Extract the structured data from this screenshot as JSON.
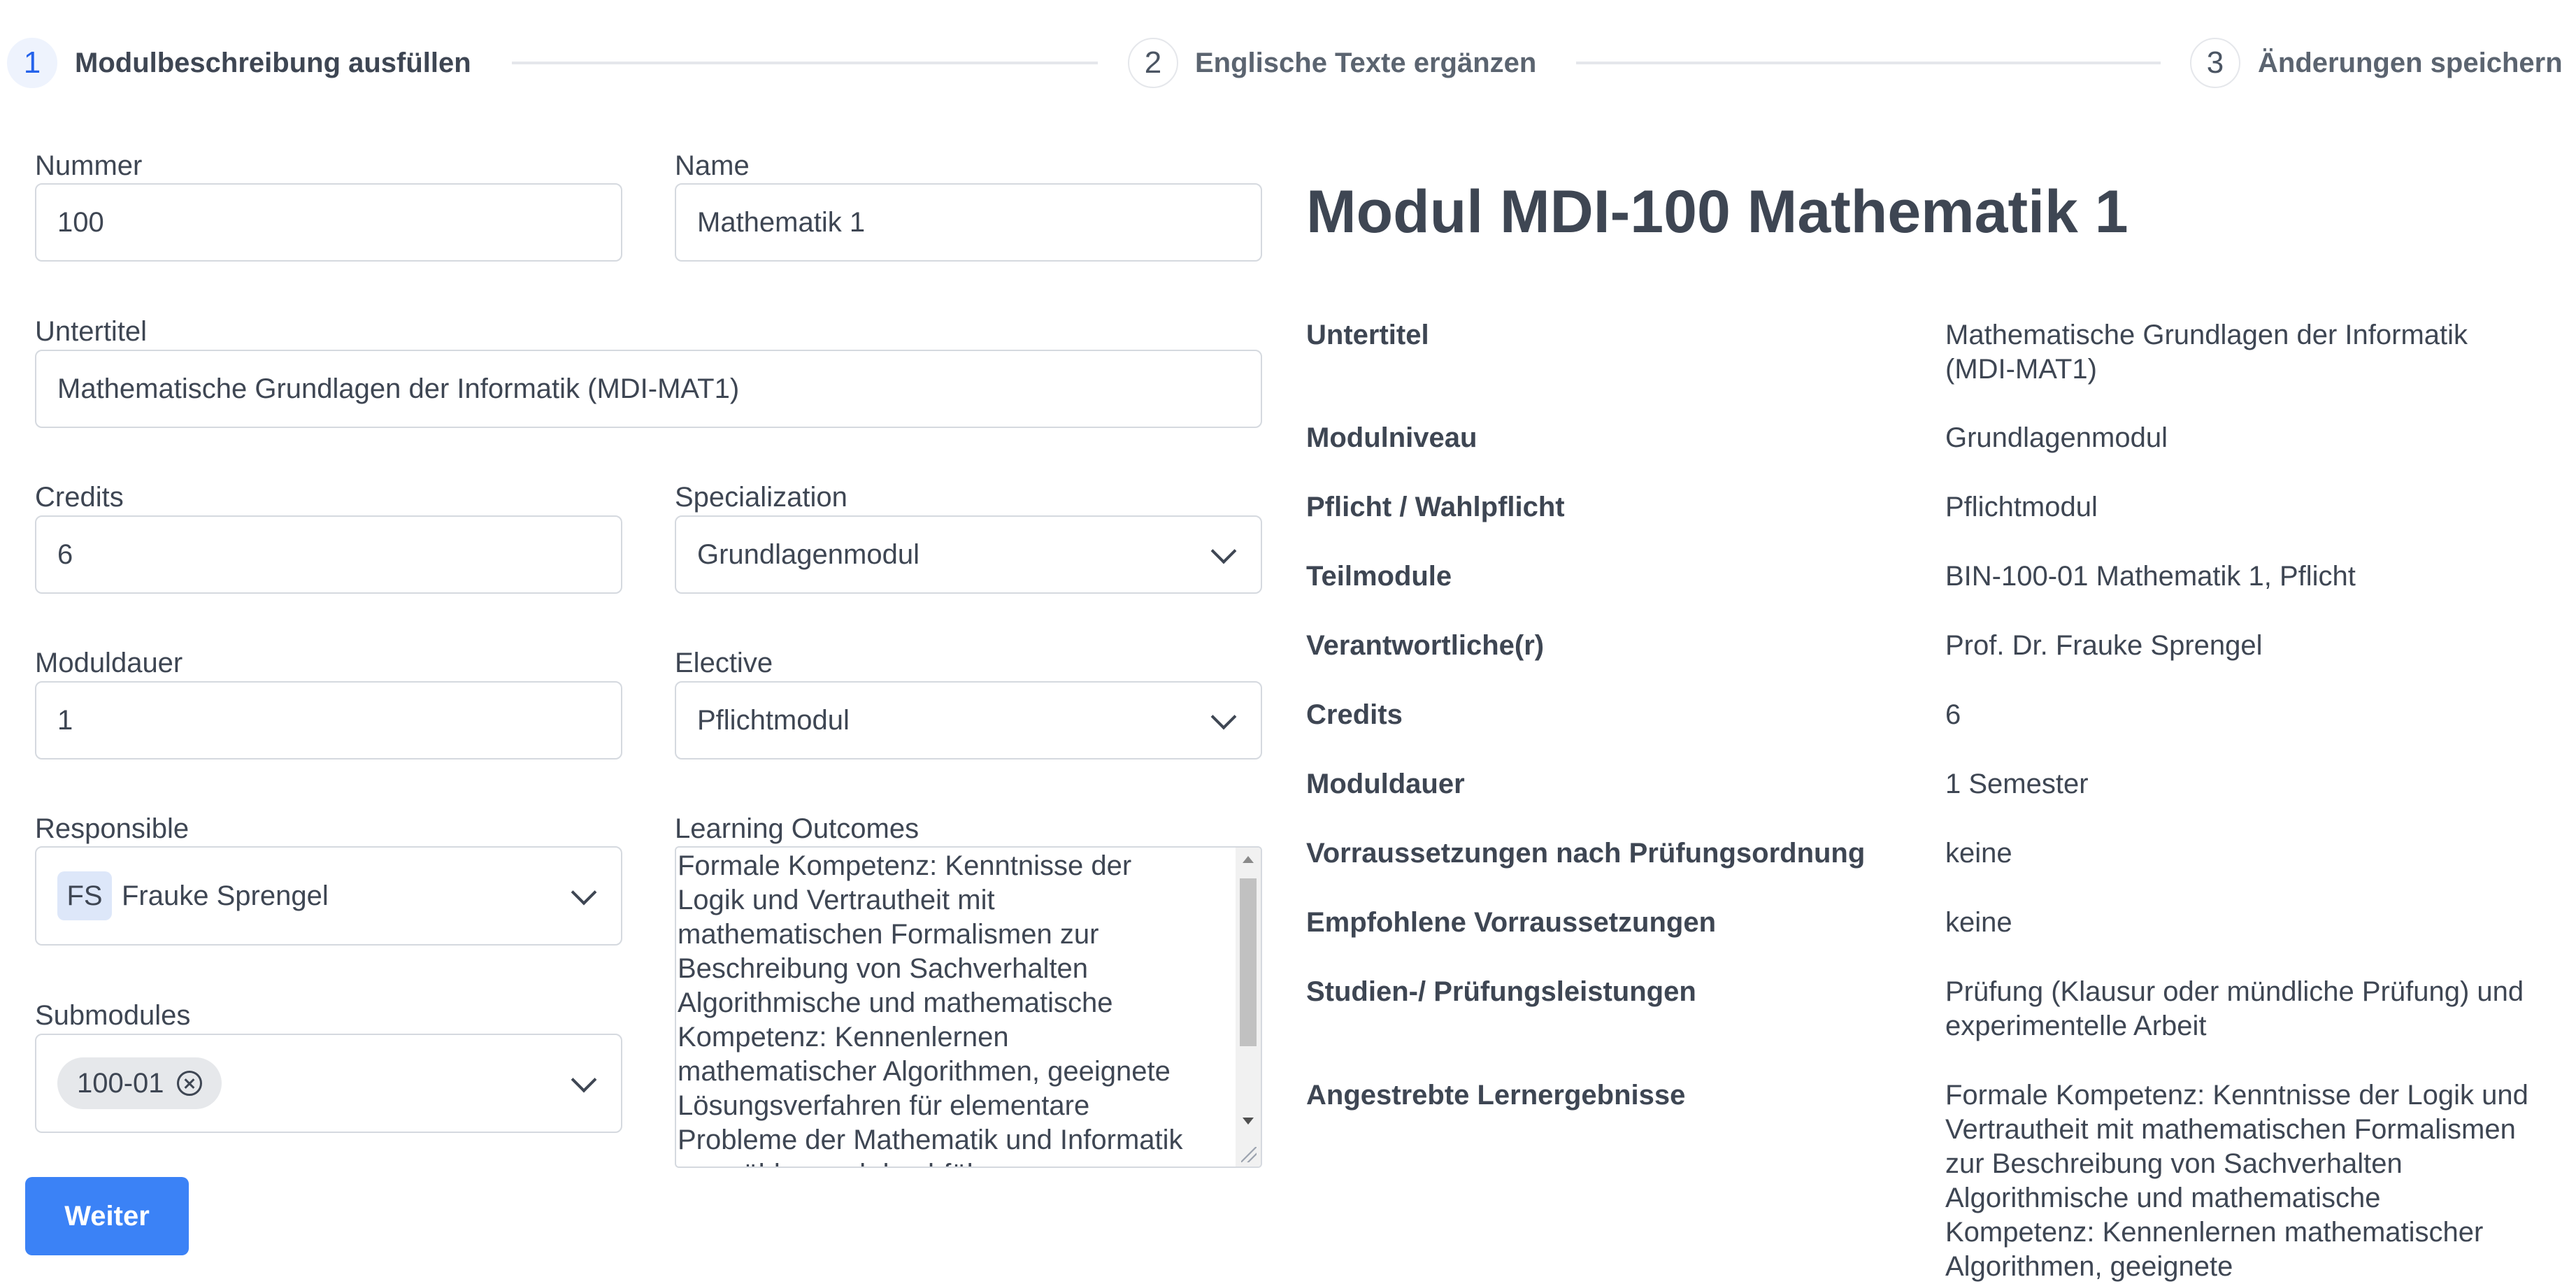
{
  "stepper": {
    "steps": [
      {
        "number": "1",
        "label": "Modulbeschreibung ausfüllen"
      },
      {
        "number": "2",
        "label": "Englische Texte ergänzen"
      },
      {
        "number": "3",
        "label": "Änderungen speichern"
      }
    ]
  },
  "form": {
    "nummer": {
      "label": "Nummer",
      "value": "100"
    },
    "name": {
      "label": "Name",
      "value": "Mathematik 1"
    },
    "untertitel": {
      "label": "Untertitel",
      "value": "Mathematische Grundlagen der Informatik (MDI-MAT1)"
    },
    "credits": {
      "label": "Credits",
      "value": "6"
    },
    "specialization": {
      "label": "Specialization",
      "value": "Grundlagenmodul"
    },
    "moduldauer": {
      "label": "Moduldauer",
      "value": "1"
    },
    "elective": {
      "label": "Elective",
      "value": "Pflichtmodul"
    },
    "responsible": {
      "label": "Responsible",
      "initials": "FS",
      "value": "Frauke Sprengel"
    },
    "learning_outcomes": {
      "label": "Learning Outcomes",
      "value": "Formale Kompetenz: Kenntnisse der\nLogik und Vertrautheit mit\nmathematischen Formalismen zur\nBeschreibung von Sachverhalten\nAlgorithmische und mathematische\nKompetenz: Kennenlernen\nmathematischer Algorithmen, geeignete\nLösungsverfahren für elementare\nProbleme der Mathematik und Informatik\nauswählen und durchführen"
    },
    "submodules": {
      "label": "Submodules",
      "tags": [
        "100-01"
      ]
    },
    "next_button": "Weiter"
  },
  "preview": {
    "title": "Modul MDI-100 Mathematik 1",
    "rows": [
      {
        "key": "Untertitel",
        "value": "Mathematische Grundlagen der Informatik (MDI-MAT1)"
      },
      {
        "key": "Modulniveau",
        "value": "Grundlagenmodul"
      },
      {
        "key": "Pflicht / Wahlpflicht",
        "value": "Pflichtmodul"
      },
      {
        "key": "Teilmodule",
        "value": "BIN-100-01 Mathematik 1, Pflicht"
      },
      {
        "key": "Verantwortliche(r)",
        "value": "Prof. Dr. Frauke Sprengel"
      },
      {
        "key": "Credits",
        "value": "6"
      },
      {
        "key": "Moduldauer",
        "value": "1 Semester"
      },
      {
        "key": "Vorraussetzungen nach Prüfungsordnung",
        "value": "keine"
      },
      {
        "key": "Empfohlene Vorraussetzungen",
        "value": "keine"
      },
      {
        "key": "Studien-/ Prüfungsleistungen",
        "value": "Prüfung (Klausur oder mündliche Prüfung) und experimentelle Arbeit"
      },
      {
        "key": "Angestrebte Lernergebnisse",
        "value": "Formale Kompetenz: Kenntnisse der Logik und Vertrautheit mit mathematischen Formalismen zur Beschreibung von Sachverhalten Algorithmische und mathematische Kompetenz: Kennenlernen mathematischer Algorithmen, geeignete"
      }
    ]
  },
  "colors": {
    "accent": "#3b82f6",
    "active_step_bg": "#eef3fd",
    "border": "#d5d9df"
  }
}
